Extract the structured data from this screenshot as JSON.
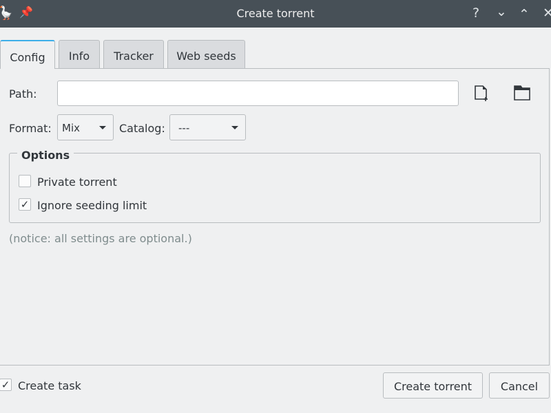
{
  "window": {
    "title": "Create torrent",
    "icons": [
      "app-goose-icon",
      "pin-icon",
      "help-icon",
      "minimize-icon",
      "maximize-icon",
      "close-icon"
    ]
  },
  "tabs": [
    {
      "label": "Config",
      "active": true
    },
    {
      "label": "Info"
    },
    {
      "label": "Tracker"
    },
    {
      "label": "Web seeds"
    }
  ],
  "config": {
    "path_label": "Path:",
    "path_value": "",
    "format_label": "Format:",
    "format_value": "Mix",
    "catalog_label": "Catalog:",
    "catalog_value": "---",
    "options_title": "Options",
    "private_torrent": {
      "label": "Private torrent",
      "checked": false
    },
    "ignore_seeding": {
      "label": "Ignore seeding limit",
      "checked": true
    },
    "notice": "(notice: all settings are optional.)"
  },
  "footer": {
    "create_task": {
      "label": "Create task",
      "checked": true
    },
    "create_button": "Create torrent",
    "cancel_button": "Cancel"
  },
  "accent": "#3daee9"
}
